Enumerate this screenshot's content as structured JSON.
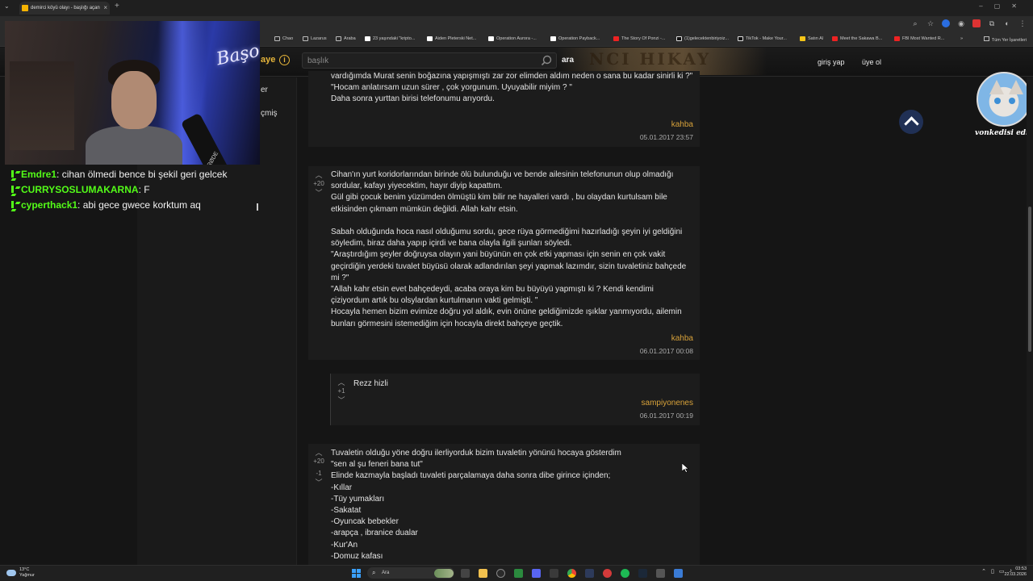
{
  "browser": {
    "tab_title": "demirci köyü olayı - başlığı açan",
    "close_tab": "×",
    "new_tab": "+",
    "bookmarks": [
      {
        "label": "Chao",
        "icon": "folder"
      },
      {
        "label": "Lazarus",
        "icon": "folder"
      },
      {
        "label": "Araba",
        "icon": "folder"
      },
      {
        "label": "23 yaşındaki \"kripto...",
        "icon": "w"
      },
      {
        "label": "Aiden Pleterski Net...",
        "icon": "w"
      },
      {
        "label": "Operation Aurora -...",
        "icon": "w"
      },
      {
        "label": "Operation Payback...",
        "icon": "w"
      },
      {
        "label": "The Story Of Ponzi -...",
        "icon": "yt"
      },
      {
        "label": "(1)gelecektenbiriyoiz...",
        "icon": "tt"
      },
      {
        "label": "TikTok - Make Your...",
        "icon": "tt"
      },
      {
        "label": "Satın Al",
        "icon": "fb"
      },
      {
        "label": "Meet the Sakawa B...",
        "icon": "yt"
      },
      {
        "label": "FBI Most Wanted R...",
        "icon": "yt"
      }
    ],
    "bookmarks_more": "»",
    "all_bookmarks": "Tüm Yer İşaretleri"
  },
  "site": {
    "logo_partial": "aye",
    "search_placeholder": "başlık",
    "search_button": "ara",
    "login": "giriş yap",
    "signup": "üye ol",
    "sidebar_partial_1": "er",
    "sidebar_partial_2": "çmiş"
  },
  "chat": [
    {
      "user": "Emdre1",
      "message": "cihan ölmedi bence bi şekil geri gelcek"
    },
    {
      "user": "CURRYSOSLUMAKARNA",
      "message": "F"
    },
    {
      "user": "cyperthack1",
      "message": "abi gece gwece korktum aq"
    }
  ],
  "webcam": {
    "neon_sign": "Başo",
    "mic_brand": "RØDE"
  },
  "entries": [
    {
      "body": "vardığımda Murat senin boğazına yapışmıştı zar zor elimden aldım neden o sana bu kadar sinirli ki ?\"\n\"Hocam anlatırsam uzun sürer , çok yorgunum. Uyuyabilir miyim ? \"\nDaha sonra yurttan birisi telefonumu arıyordu.",
      "author": "kahba",
      "date": "05.01.2017 23:57"
    },
    {
      "score": "+20",
      "body": "Cihan'ın yurt koridorlarından birinde ölü bulunduğu ve bende ailesinin telefonunun olup olmadığı sordular, kafayı yiyecektim, hayır diyip kapattım.\nGül gibi çocuk benim yüzümden ölmüştü kim bilir ne hayalleri vardı , bu olaydan kurtulsam bile etkisinden çıkmam mümkün değildi. Allah kahr etsin.\n\nSabah olduğunda hoca nasıl olduğumu sordu, gece rüya görmediğimi hazırladığı şeyin iyi geldiğini söyledim, biraz daha yapıp içirdi ve bana olayla ilgili şunları söyledi.\n\"Araştırdığım şeyler doğruysa olayın yani büyünün en çok etki yapması için senin en çok vakit geçirdiğin yerdeki tuvalet büyüsü olarak adlandırılan şeyi yapmak lazımdır, sizin tuvaletiniz bahçede mi ?\"\n\"Allah kahr etsin evet bahçedeydi, acaba oraya kim bu büyüyü yapmıştı ki ? Kendi kendimi çiziyordum artık bu olsylardan kurtulmanın vakti gelmişti. \"\nHocayla hemen bizim evimize doğru yol aldık, evin önüne geldiğimizde ışıklar yanmıyordu, ailemin bunları görmesini istemediğim için hocayla direkt bahçeye geçtik.",
      "author": "kahba",
      "date": "06.01.2017 00:08"
    },
    {
      "score": "+1",
      "body": "Rezz hizli",
      "author": "sampiyonenes",
      "date": "06.01.2017 00:19"
    },
    {
      "score": "+20",
      "score_down": "-1",
      "body": "Tuvaletin olduğu yöne doğru ilerliyorduk bizim tuvaletin yönünü hocaya gösterdim\n\"sen al şu feneri bana tut\"\nElinde kazmayla başladı tuvaleti parçalamaya daha sonra dibe girince içinden;\n-Kıllar\n-Tüy yumakları\n-Sakatat\n-Oyuncak bebekler\n-arapça , ibranice dualar\n-Kur'An\n-Domuz kafası"
    }
  ],
  "avatar_label": "vonkedisi edin",
  "taskbar": {
    "weather_temp": "13°C",
    "weather_desc": "Yağmur",
    "search_placeholder": "Ara",
    "time": "03:53",
    "date": "22.03.2026"
  },
  "colors": {
    "accent": "#d8a23a",
    "chat_user": "#53fc18",
    "background": "#151515",
    "entry_bg": "#1c1c1c"
  }
}
